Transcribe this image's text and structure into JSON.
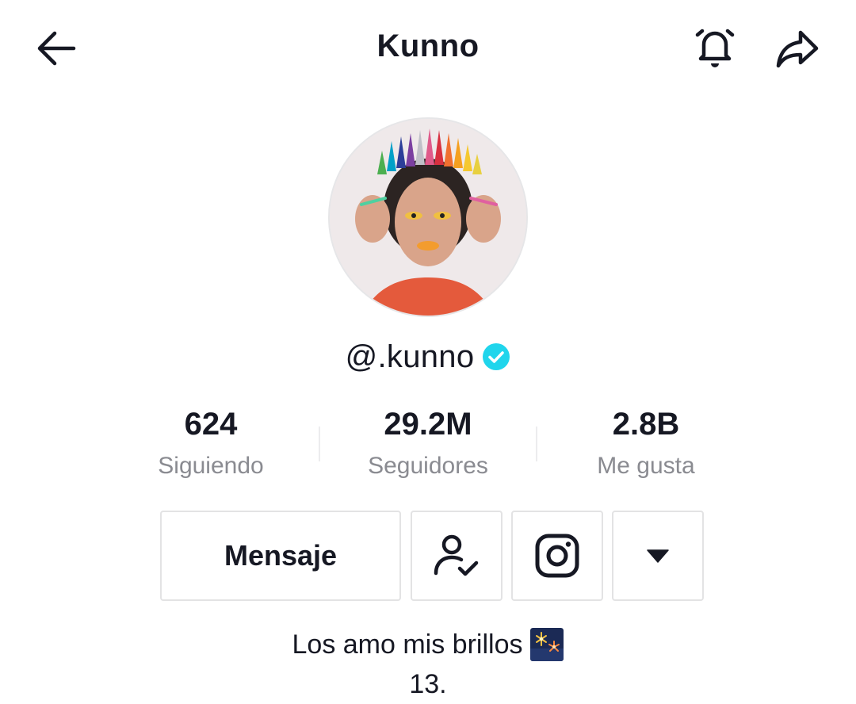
{
  "header": {
    "title": "Kunno",
    "back_icon": "arrow-left-icon",
    "bell_icon": "bell-icon",
    "share_icon": "share-arrow-icon"
  },
  "profile": {
    "avatar": "profile-avatar",
    "handle": "@.kunno",
    "verified_icon": "verified-badge-icon",
    "verified_color": "#20d5ec"
  },
  "stats": [
    {
      "value": "624",
      "label": "Siguiendo"
    },
    {
      "value": "29.2M",
      "label": "Seguidores"
    },
    {
      "value": "2.8B",
      "label": "Me gusta"
    }
  ],
  "actions": {
    "message_label": "Mensaje",
    "following_icon": "user-check-icon",
    "instagram_icon": "instagram-icon",
    "more_icon": "caret-down-icon"
  },
  "bio": {
    "line1": "Los amo mis brillos",
    "line1_emoji": "fireworks-emoji",
    "line2": "13."
  }
}
